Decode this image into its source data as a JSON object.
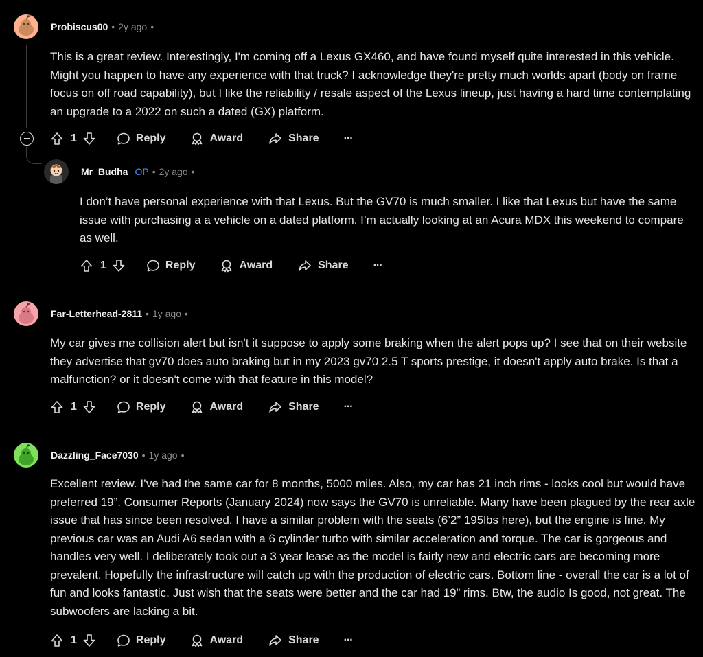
{
  "comments": [
    {
      "username": "Probiscus00",
      "time": "2y ago",
      "text": "This is a great review. Interestingly, I'm coming off a Lexus GX460, and have found myself quite interested in this vehicle. Might you happen to have any experience with that truck? I acknowledge they're pretty much worlds apart (body on frame focus on off road capability), but I like the reliability / resale aspect of the Lexus lineup, just having a hard time contemplating an upgrade to a 2022 on such a dated (GX) platform.",
      "votes": "1",
      "avatar_color": "#ffb18c"
    },
    {
      "username": "Mr_Budha",
      "op_badge": "OP",
      "time": "2y ago",
      "text": "I don’t have personal experience with that Lexus. But the GV70 is much smaller. I like that Lexus but have the same issue with purchasing a a vehicle on a dated platform. I’m actually looking at an Acura MDX this weekend to compare as well.",
      "votes": "1",
      "avatar_color": "#2a2a2a"
    },
    {
      "username": "Far-Letterhead-2811",
      "time": "1y ago",
      "text": "My car gives me collision alert but isn't it suppose to apply some braking when the alert pops up? I see that on their website they advertise that gv70 does auto braking but in my 2023 gv70 2.5 T sports prestige, it doesn't apply auto brake. Is that a malfunction? or it doesn't come with that feature in this model?",
      "votes": "1",
      "avatar_color": "#f7a3ab"
    },
    {
      "username": "Dazzling_Face7030",
      "time": "1y ago",
      "text": "Excellent review. I’ve had the same car for 8 months, 5000 miles. Also, my car has 21 inch rims - looks cool but would have preferred 19”. Consumer Reports (January 2024) now says the GV70 is unreliable. Many have been plagued by the rear axle issue that has since been resolved. I have a similar problem with the seats (6’2” 195lbs here), but the engine is fine. My previous car was an Audi A6 sedan with a 6 cylinder turbo with similar acceleration and torque. The car is gorgeous and handles very well. I deliberately took out a 3 year lease as the model is fairly new and electric cars are becoming more prevalent. Hopefully the infrastructure will catch up with the production of electric cars. Bottom line - overall the car is a lot of fun and looks fantastic. Just wish that the seats were better and the car had 19” rims. Btw, the audio Is good, not great. The subwoofers are lacking a bit.",
      "votes": "1",
      "avatar_color": "#7fe05a"
    }
  ],
  "actions": {
    "reply": "Reply",
    "award": "Award",
    "share": "Share",
    "more": "···"
  }
}
